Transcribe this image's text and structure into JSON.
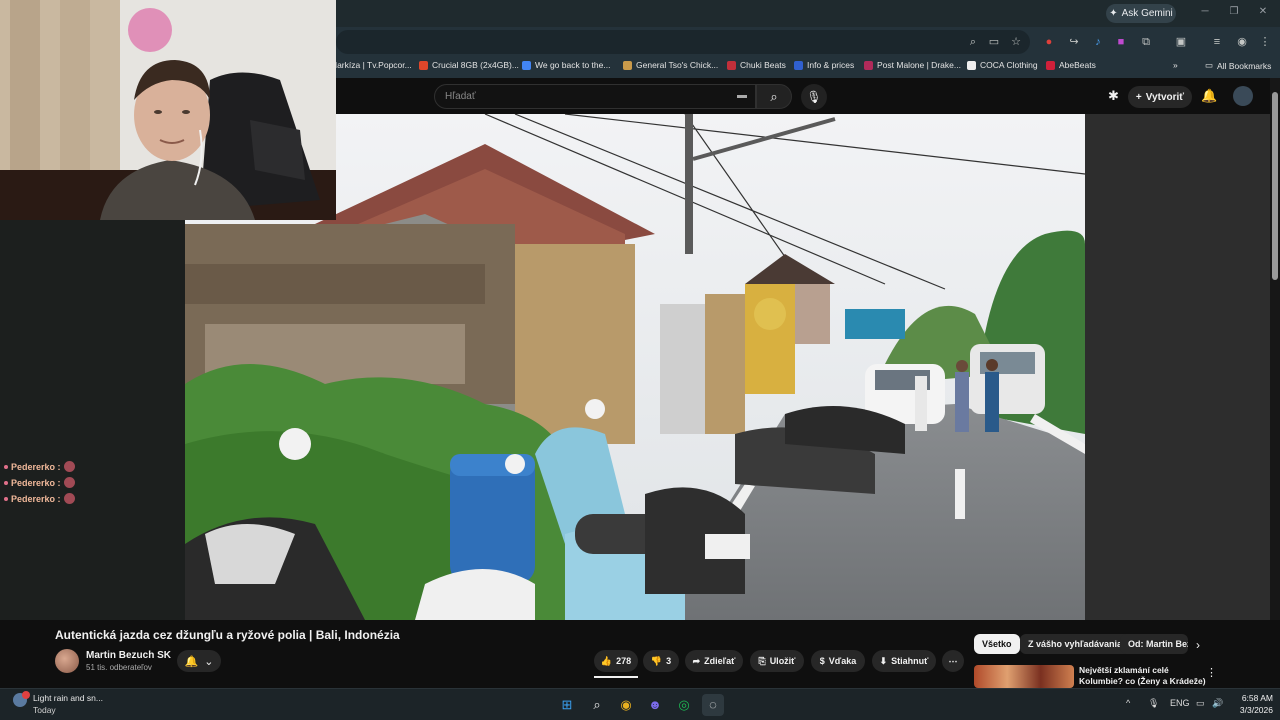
{
  "browser": {
    "gemini_label": "Ask Gemini",
    "bookmarks": [
      {
        "label": "Markíza | Tv.Popcor...",
        "color": "#7a2a8a"
      },
      {
        "label": "Crucial 8GB (2x4GB)...",
        "color": "#e0462a"
      },
      {
        "label": "We go back to the...",
        "color": "#4285f4"
      },
      {
        "label": "General Tso's Chick...",
        "color": "#c99a4a"
      },
      {
        "label": "Chuki Beats",
        "color": "#c22f3a"
      },
      {
        "label": "Info & prices",
        "color": "#3060d0"
      },
      {
        "label": "Post Malone | Drake...",
        "color": "#b02a5a"
      },
      {
        "label": "COCA Clothing",
        "color": "#222222"
      },
      {
        "label": "AbeBeats",
        "color": "#d0203a"
      }
    ],
    "all_bookmarks_label": "All Bookmarks"
  },
  "youtube": {
    "search_placeholder": "Hľadať",
    "create_label": "Vytvoriť",
    "video_title": "Autentická jazda cez džungľu a ryžové polia | Bali, Indonézia",
    "channel_name": "Martin Bezuch SK",
    "subscribers": "51 tis. odberateľov",
    "like_count": "278",
    "dislike_count": "3",
    "share_label": "Zdieľať",
    "save_label": "Uložiť",
    "thanks_label": "Vďaka",
    "download_label": "Stiahnuť",
    "chips": [
      "Všetko",
      "Z vášho vyhľadávania",
      "Od: Martin Bez"
    ],
    "related_title": "Největší zklamání celé Kolumbie? co (Ženy a Krádeže)"
  },
  "chat": {
    "lines": [
      {
        "user": "Pedererko :"
      },
      {
        "user": "Pedererko :"
      },
      {
        "user": "Pedererko :"
      }
    ]
  },
  "taskbar": {
    "weather_line1": "Light rain and sn...",
    "weather_line2": "Today",
    "lang": "ENG",
    "time": "6:58 AM",
    "date": "3/3/2026"
  }
}
